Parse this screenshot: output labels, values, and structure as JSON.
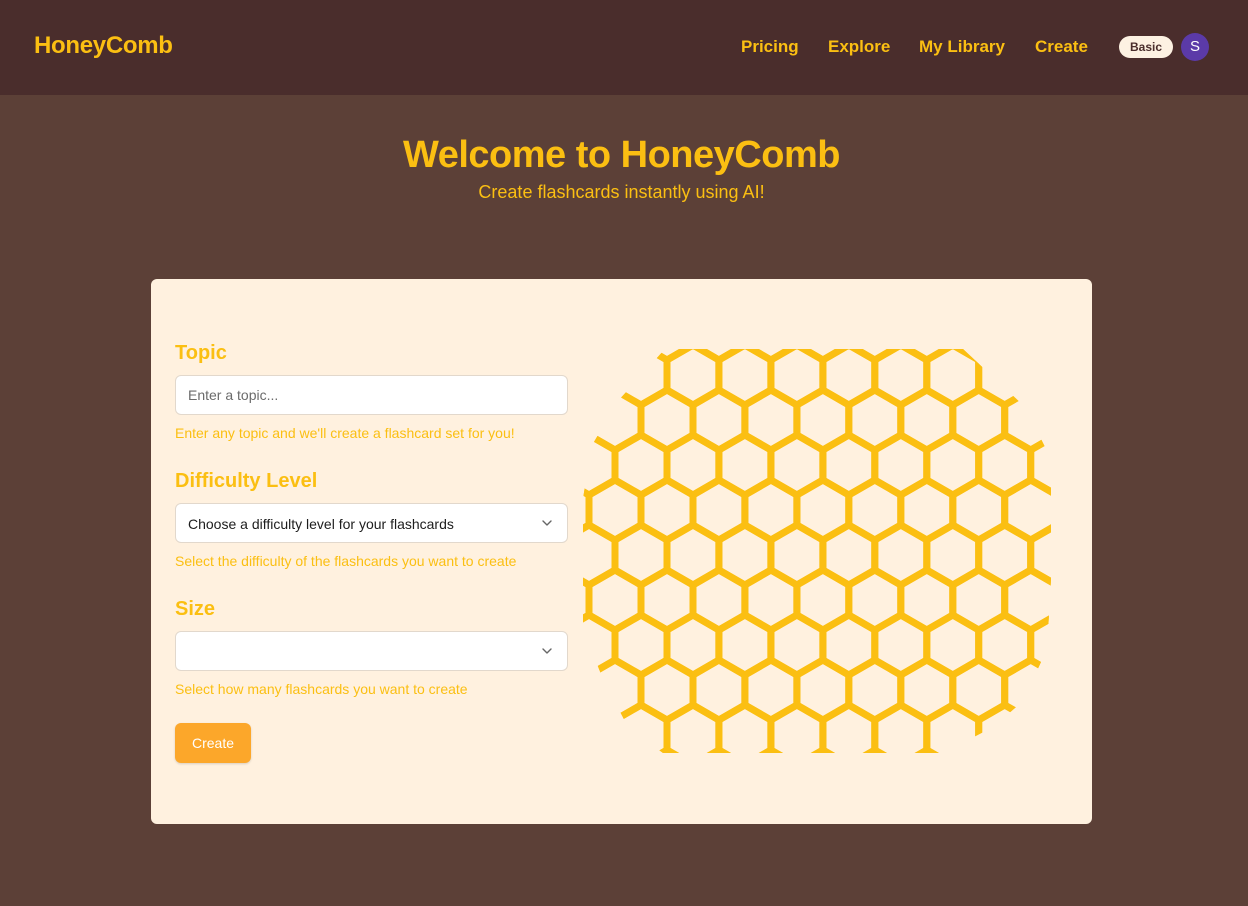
{
  "brand": "HoneyComb",
  "nav": {
    "links": [
      "Pricing",
      "Explore",
      "My Library",
      "Create"
    ],
    "plan_badge": "Basic",
    "avatar_initial": "S"
  },
  "hero": {
    "title": "Welcome to HoneyComb",
    "subtitle": "Create flashcards instantly using AI!"
  },
  "form": {
    "topic": {
      "label": "Topic",
      "placeholder": "Enter a topic...",
      "value": "",
      "helper": "Enter any topic and we'll create a flashcard set for you!"
    },
    "difficulty": {
      "label": "Difficulty Level",
      "selected": "Choose a difficulty level for your flashcards",
      "helper": "Select the difficulty of the flashcards you want to create"
    },
    "size": {
      "label": "Size",
      "selected": "",
      "helper": "Select how many flashcards you want to create"
    },
    "submit_label": "Create"
  },
  "illustration": "honeycomb-pattern",
  "colors": {
    "page_bg": "#5c4037",
    "navbar_bg": "#4a2d2c",
    "accent": "#fbbf12",
    "card_bg": "#fff1df",
    "button": "#fca72a",
    "avatar_bg": "#5b3aa8"
  }
}
